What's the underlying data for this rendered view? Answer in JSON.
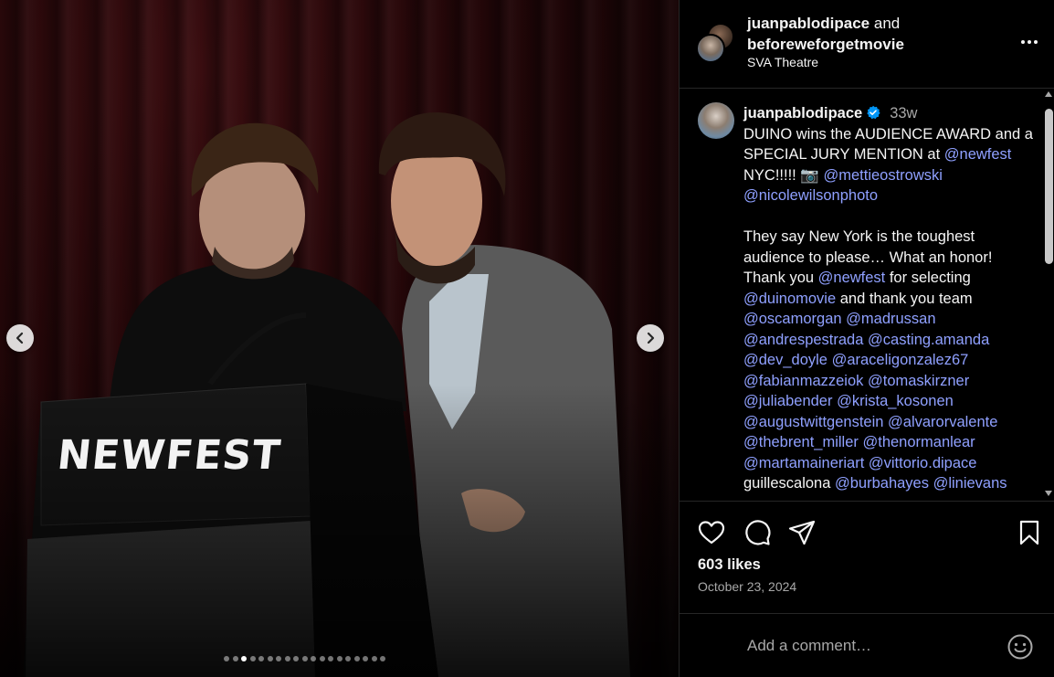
{
  "media": {
    "podium_text": "NEWFEST",
    "carousel_total": 19,
    "carousel_active_index": 2
  },
  "header": {
    "user1": "juanpablodipace",
    "and_text": "and",
    "user2": "beforeweforgetmovie",
    "location": "SVA Theatre"
  },
  "caption": {
    "username": "juanpablodipace",
    "time": "33w",
    "line1_text": "DUINO wins the AUDIENCE AWARD and a SPECIAL JURY MENTION at ",
    "m_newfest": "@newfest",
    "line1_tail": " NYC!!!!! 📷 ",
    "m_mettie": "@mettieostrowski",
    "m_nicole": "@nicolewilsonphoto",
    "p2_a": "They say New York is the toughest audience to please… What an honor! Thank you ",
    "m_newfest2": "@newfest",
    "p2_b": " for selecting ",
    "m_duino": "@duinomovie",
    "p2_c": " and thank you team ",
    "mentions": [
      "@oscamorgan",
      "@madrussan",
      "@andrespestrada",
      "@casting.amanda",
      "@dev_doyle",
      "@araceligonzalez67",
      "@fabianmazzeiok",
      "@tomaskirzner",
      "@juliabender",
      "@krista_kosonen",
      "@augustwittgenstein",
      "@alvarorvalente",
      "@thebrent_miller",
      "@thenormanlear",
      "@martamaineriart",
      "@vittorio.dipace"
    ],
    "plain_name": "guillescalona",
    "mentions_after": [
      "@burbahayes",
      "@linievans"
    ]
  },
  "actions": {
    "like_icon": "heart-icon",
    "comment_icon": "comment-icon",
    "share_icon": "share-icon",
    "save_icon": "bookmark-icon"
  },
  "likes": "603 likes",
  "date": "October 23, 2024",
  "comment": {
    "placeholder": "Add a comment…"
  },
  "colors": {
    "mention": "#8fa0ff",
    "verified": "#0095f6",
    "muted": "#a8a8a8"
  }
}
